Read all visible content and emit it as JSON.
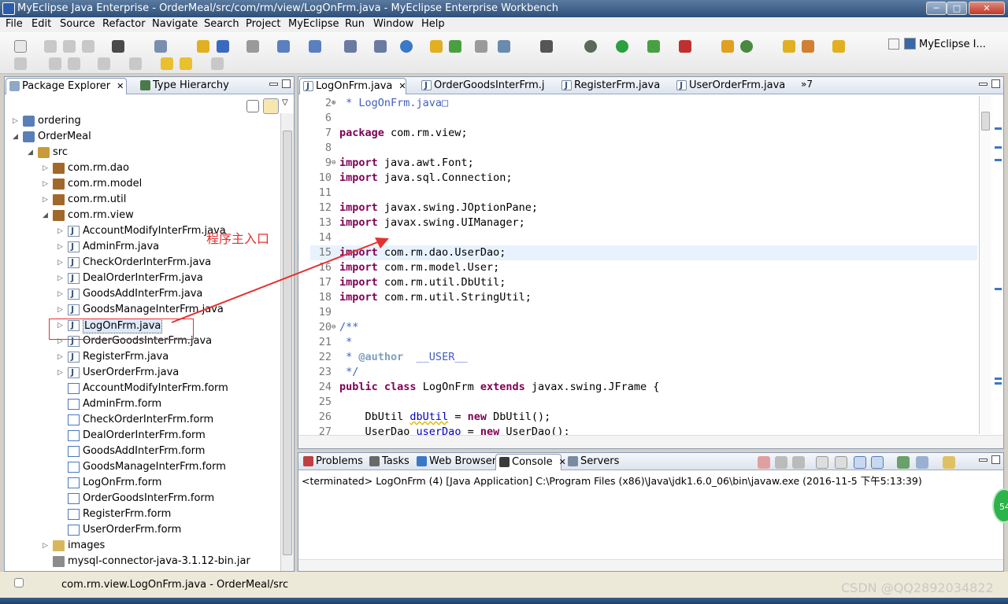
{
  "window": {
    "title": "MyEclipse Java Enterprise - OrderMeal/src/com/rm/view/LogOnFrm.java - MyEclipse Enterprise Workbench",
    "min": "─",
    "max": "□",
    "close": "✕"
  },
  "menu": [
    "File",
    "Edit",
    "Source",
    "Refactor",
    "Navigate",
    "Search",
    "Project",
    "MyEclipse",
    "Run",
    "Window",
    "Help"
  ],
  "perspective": {
    "label": "MyEclipse I..."
  },
  "explorer": {
    "tabs": [
      {
        "label": "Package Explorer",
        "close": "✕"
      },
      {
        "label": "Type Hierarchy"
      }
    ],
    "tree": [
      {
        "label": "ordering",
        "icon": "project-icon",
        "twisty": "▷"
      },
      {
        "label": "OrderMeal",
        "icon": "project-icon",
        "twisty": "◢"
      },
      {
        "label": "src",
        "icon": "source-folder-icon",
        "twisty": "◢"
      },
      {
        "label": "com.rm.dao",
        "icon": "package-icon",
        "twisty": "▷"
      },
      {
        "label": "com.rm.model",
        "icon": "package-icon",
        "twisty": "▷"
      },
      {
        "label": "com.rm.util",
        "icon": "package-icon",
        "twisty": "▷"
      },
      {
        "label": "com.rm.view",
        "icon": "package-icon",
        "twisty": "◢"
      },
      {
        "label": "AccountModifyInterFrm.java",
        "icon": "java-file-icon",
        "twisty": "▷"
      },
      {
        "label": "AdminFrm.java",
        "icon": "java-file-icon",
        "twisty": "▷"
      },
      {
        "label": "CheckOrderInterFrm.java",
        "icon": "java-file-icon",
        "twisty": "▷"
      },
      {
        "label": "DealOrderInterFrm.java",
        "icon": "java-file-icon",
        "twisty": "▷"
      },
      {
        "label": "GoodsAddInterFrm.java",
        "icon": "java-file-icon",
        "twisty": "▷"
      },
      {
        "label": "GoodsManageInterFrm.java",
        "icon": "java-file-icon",
        "twisty": "▷"
      },
      {
        "label": "LogOnFrm.java",
        "icon": "java-file-icon",
        "twisty": "▷",
        "selected": true
      },
      {
        "label": "OrderGoodsInterFrm.java",
        "icon": "java-file-icon",
        "twisty": "▷"
      },
      {
        "label": "RegisterFrm.java",
        "icon": "java-file-icon",
        "twisty": "▷"
      },
      {
        "label": "UserOrderFrm.java",
        "icon": "java-file-icon",
        "twisty": "▷"
      },
      {
        "label": "AccountModifyInterFrm.form",
        "icon": "form-file-icon"
      },
      {
        "label": "AdminFrm.form",
        "icon": "form-file-icon"
      },
      {
        "label": "CheckOrderInterFrm.form",
        "icon": "form-file-icon"
      },
      {
        "label": "DealOrderInterFrm.form",
        "icon": "form-file-icon"
      },
      {
        "label": "GoodsAddInterFrm.form",
        "icon": "form-file-icon"
      },
      {
        "label": "GoodsManageInterFrm.form",
        "icon": "form-file-icon"
      },
      {
        "label": "LogOnFrm.form",
        "icon": "form-file-icon"
      },
      {
        "label": "OrderGoodsInterFrm.form",
        "icon": "form-file-icon"
      },
      {
        "label": "RegisterFrm.form",
        "icon": "form-file-icon"
      },
      {
        "label": "UserOrderFrm.form",
        "icon": "form-file-icon"
      },
      {
        "label": "images",
        "icon": "folder-icon",
        "twisty": "▷"
      },
      {
        "label": "mysql-connector-java-3.1.12-bin.jar",
        "icon": "jar-icon"
      }
    ]
  },
  "editor": {
    "tabs": [
      {
        "label": "LogOnFrm.java",
        "close": "✕",
        "active": true
      },
      {
        "label": "OrderGoodsInterFrm.j"
      },
      {
        "label": "RegisterFrm.java"
      },
      {
        "label": "UserOrderFrm.java"
      }
    ],
    "overflow": "»7",
    "lines": [
      {
        "n": "2",
        "fold": "⊕",
        "parts": [
          {
            "t": " * LogOnFrm.java",
            "c": "cm"
          },
          {
            "t": "□",
            "c": "cm"
          }
        ]
      },
      {
        "n": "6",
        "parts": []
      },
      {
        "n": "7",
        "parts": [
          {
            "t": "package",
            "c": "kw"
          },
          {
            "t": " com.rm.view;"
          }
        ]
      },
      {
        "n": "8",
        "parts": []
      },
      {
        "n": "9",
        "fold": "⊖",
        "parts": [
          {
            "t": "import",
            "c": "kw"
          },
          {
            "t": " java.awt.Font;"
          }
        ]
      },
      {
        "n": "10",
        "parts": [
          {
            "t": "import",
            "c": "kw"
          },
          {
            "t": " java.sql.Connection;"
          }
        ]
      },
      {
        "n": "11",
        "parts": []
      },
      {
        "n": "12",
        "parts": [
          {
            "t": "import",
            "c": "kw"
          },
          {
            "t": " javax.swing.JOptionPane;"
          }
        ]
      },
      {
        "n": "13",
        "parts": [
          {
            "t": "import",
            "c": "kw"
          },
          {
            "t": " javax.swing.UIManager;"
          }
        ]
      },
      {
        "n": "14",
        "parts": []
      },
      {
        "n": "15",
        "current": true,
        "parts": [
          {
            "t": "import",
            "c": "kw"
          },
          {
            "t": " com.rm.dao.UserDao;"
          }
        ]
      },
      {
        "n": "16",
        "parts": [
          {
            "t": "import",
            "c": "kw"
          },
          {
            "t": " com.rm.model.User;"
          }
        ]
      },
      {
        "n": "17",
        "parts": [
          {
            "t": "import",
            "c": "kw"
          },
          {
            "t": " com.rm.util.DbUtil;"
          }
        ]
      },
      {
        "n": "18",
        "parts": [
          {
            "t": "import",
            "c": "kw"
          },
          {
            "t": " com.rm.util.StringUtil;"
          }
        ]
      },
      {
        "n": "19",
        "parts": []
      },
      {
        "n": "20",
        "fold": "⊖",
        "parts": [
          {
            "t": "/**",
            "c": "cm"
          }
        ]
      },
      {
        "n": "21",
        "parts": [
          {
            "t": " *",
            "c": "cm"
          }
        ]
      },
      {
        "n": "22",
        "parts": [
          {
            "t": " * ",
            "c": "cm"
          },
          {
            "t": "@author",
            "c": "tg"
          },
          {
            "t": "  __USER__",
            "c": "cm"
          }
        ]
      },
      {
        "n": "23",
        "parts": [
          {
            "t": " */",
            "c": "cm"
          }
        ]
      },
      {
        "n": "24",
        "parts": [
          {
            "t": "public",
            "c": "kw"
          },
          {
            "t": " "
          },
          {
            "t": "class",
            "c": "kw"
          },
          {
            "t": " LogOnFrm "
          },
          {
            "t": "extends",
            "c": "kw"
          },
          {
            "t": " javax.swing.JFrame {"
          }
        ]
      },
      {
        "n": "25",
        "parts": []
      },
      {
        "n": "26",
        "parts": [
          {
            "t": "    DbUtil "
          },
          {
            "t": "dbUtil",
            "c": "fd"
          },
          {
            "t": " = "
          },
          {
            "t": "new",
            "c": "kw"
          },
          {
            "t": " DbUtil();"
          }
        ]
      },
      {
        "n": "27",
        "parts": [
          {
            "t": "    UserDao "
          },
          {
            "t": "userDao",
            "c": "fd"
          },
          {
            "t": " = "
          },
          {
            "t": "new",
            "c": "kw"
          },
          {
            "t": " UserDao();"
          }
        ]
      }
    ]
  },
  "console": {
    "tabs": [
      {
        "label": "Problems",
        "icon": "problems-icon"
      },
      {
        "label": "Tasks",
        "icon": "tasks-icon"
      },
      {
        "label": "Web Browser",
        "icon": "globe-icon"
      },
      {
        "label": "Console",
        "icon": "console-icon",
        "close": "✕",
        "active": true
      },
      {
        "label": "Servers",
        "icon": "servers-icon"
      }
    ],
    "status": "<terminated> LogOnFrm (4) [Java Application] C:\\Program Files (x86)\\Java\\jdk1.6.0_06\\bin\\javaw.exe (2016-11-5 下午5:13:39)"
  },
  "statusbar": {
    "path": "com.rm.view.LogOnFrm.java - OrderMeal/src"
  },
  "annotation": {
    "text": "程序主入口"
  },
  "watermark": "CSDN @QQ2892034822",
  "bubble": "54"
}
